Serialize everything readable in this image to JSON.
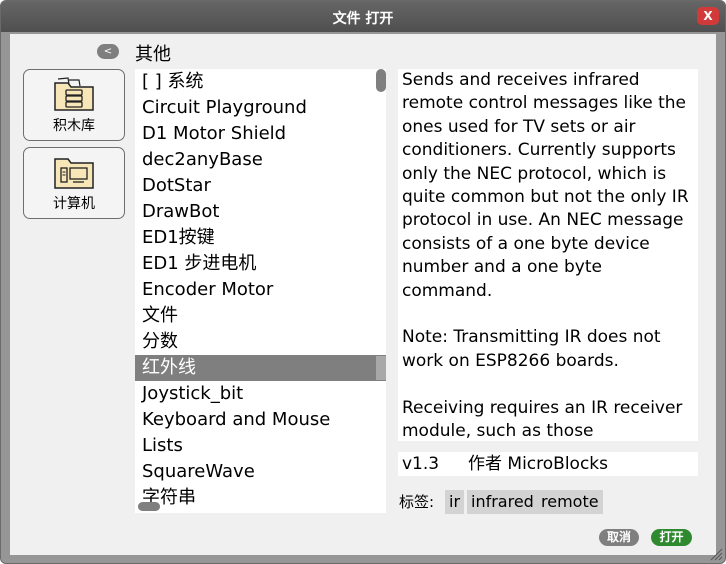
{
  "window": {
    "title": "文件 打开",
    "close_label": "X"
  },
  "nav": {
    "back_label": "<",
    "current_folder": "其他"
  },
  "sidebar": {
    "items": [
      {
        "label": "积木库",
        "icon": "library-folder-icon"
      },
      {
        "label": "计算机",
        "icon": "computer-folder-icon"
      }
    ]
  },
  "file_list": {
    "items": [
      "[ ] 系统",
      "Circuit Playground",
      "D1 Motor Shield",
      "dec2anyBase",
      "DotStar",
      "DrawBot",
      "ED1按键",
      "ED1 步进电机",
      "Encoder Motor",
      "文件",
      "分数",
      "红外线",
      "Joystick_bit",
      "Keyboard and Mouse",
      "Lists",
      "SquareWave",
      "字符串"
    ],
    "selected_index": 11
  },
  "description": {
    "paragraphs": [
      "Sends and receives infrared remote control messages like the ones used for TV sets or air conditioners. Currently supports only the NEC protocol, which is quite common but not the only IR protocol in use. An NEC message consists of a one byte device number and a one byte command.",
      "Note: Transmitting IR does not work on ESP8266 boards.",
      "Receiving requires an IR receiver module, such as those"
    ]
  },
  "meta": {
    "version": "v1.3",
    "author": "作者 MicroBlocks",
    "tags_label": "标签:",
    "tags": [
      "ir",
      "infrared",
      "remote"
    ]
  },
  "actions": {
    "cancel_label": "取消",
    "open_label": "打开"
  },
  "colors": {
    "open_button": "#2f8a2f",
    "cancel_button": "#7f7f7f",
    "selection": "#7f7f7f",
    "close_button": "#d23a3a"
  }
}
